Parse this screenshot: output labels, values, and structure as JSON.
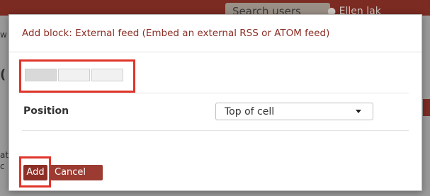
{
  "background": {
    "search_label": "Search users",
    "user_text": "Ellen lak",
    "left_fragments": [
      "w",
      "(",
      "at",
      "c"
    ]
  },
  "modal": {
    "title": "Add block: External feed (Embed an external RSS or ATOM feed)",
    "close_icon": "close-icon",
    "tabs": [
      {
        "state": "active"
      },
      {
        "state": "inactive"
      },
      {
        "state": "inactive"
      }
    ],
    "position_label": "Position",
    "position_select": {
      "selected": "Top of cell"
    },
    "buttons": {
      "add_label": "Add",
      "cancel_label": "Cancel"
    }
  },
  "colors": {
    "brand": "#8c2f26",
    "highlight": "#e0342a"
  }
}
